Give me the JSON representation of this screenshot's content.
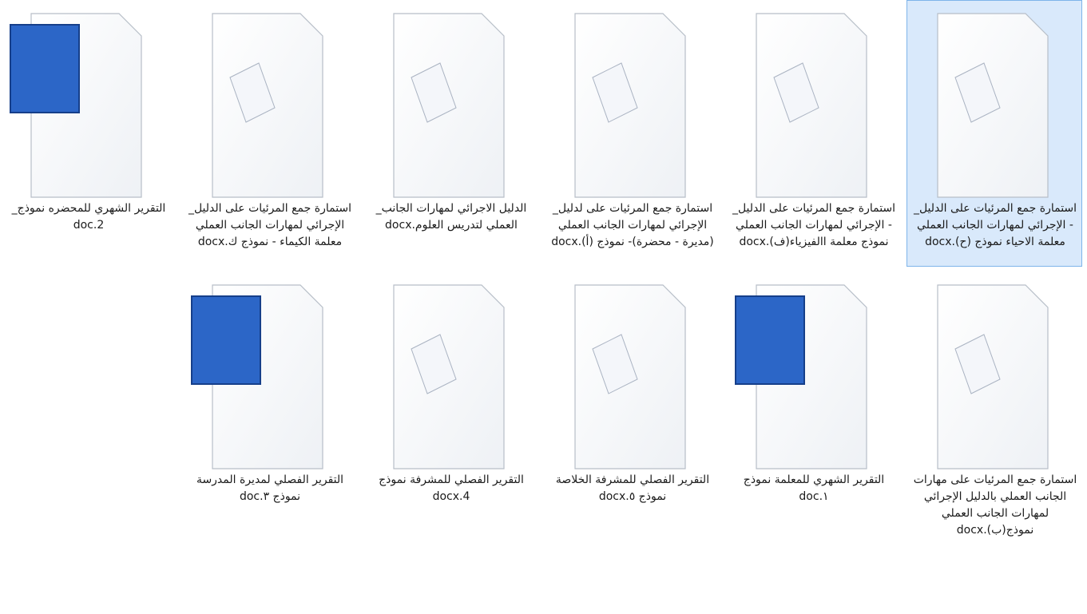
{
  "window": {
    "view": "Large icons",
    "selected_file": "استمارة جمع المرئيات على الدليل_ - الإجرائي لمهارات الجانب العملي معلمة الاحياء نموذج (ح).docx"
  },
  "files": [
    {
      "name": "استمارة جمع المرئيات على الدليل_ - الإجرائي لمهارات الجانب العملي معلمة الاحياء نموذج (ح).docx",
      "lines": [
        "استمارة جمع المرئيات على الدليل_",
        "- الإجرائي لمهارات الجانب العملي",
        "معلمة الاحياء نموذج (ح).docx"
      ],
      "type": "docx",
      "icon": "word-2007-document-icon"
    },
    {
      "name": "استمارة جمع المرئيات على الدليل_ - الإجرائي لمهارات الجانب العملي نموذج معلمة االفيزياء(ف).docx",
      "lines": [
        "استمارة جمع المرئيات على الدليل_",
        "- الإجرائي لمهارات الجانب العملي",
        "نموذج معلمة االفيزياء(ف).docx"
      ],
      "type": "docx",
      "icon": "word-2007-document-icon"
    },
    {
      "name": "استمارة جمع المرئيات على لدليل_ الإجرائي لمهارات الجانب العملي (مديرة - محضرة)- نموذج (أ).docx",
      "lines": [
        "استمارة جمع المرئيات على لدليل_",
        "الإجرائي لمهارات الجانب العملي",
        "(مديرة - محضرة)- نموذج (أ).docx"
      ],
      "type": "docx",
      "icon": "word-2007-document-icon"
    },
    {
      "name": "الدليل الاجرائي لمهارات الجانب_ العملي لتدريس العلوم.docx",
      "lines": [
        "الدليل الاجرائي لمهارات الجانب_",
        "العملي لتدريس العلوم.docx"
      ],
      "type": "docx",
      "icon": "word-2007-document-icon"
    },
    {
      "name": "استمارة جمع المرئيات على الدليل_ الإجرائي لمهارات الجانب العملي معلمة الكيماء - نموذج ك.docx",
      "lines": [
        "استمارة جمع المرئيات على الدليل_",
        "الإجرائي لمهارات الجانب العملي",
        "معلمة الكيماء - نموذج ك.docx"
      ],
      "type": "docx",
      "icon": "word-2007-document-icon"
    },
    {
      "name": "التقرير الشهري للمحضره نموذج_2.doc",
      "lines": [
        "التقرير الشهري للمحضره نموذج_",
        "2.doc"
      ],
      "type": "doc",
      "icon": "word-2003-document-icon"
    },
    {
      "name": "استمارة جمع المرئيات على مهارات الجانب العملي بالدليل الإجرائي لمهارات الجانب العملي نموذج(ب).docx",
      "lines": [
        "استمارة جمع المرئيات على مهارات",
        "الجانب العملي بالدليل الإجرائي",
        "لمهارات الجانب العملي",
        "نموذج(ب).docx"
      ],
      "type": "docx",
      "icon": "word-2007-document-icon"
    },
    {
      "name": "التقرير الشهري للمعلمة نموذج ١.doc",
      "lines": [
        "التقرير الشهري للمعلمة  نموذج ١.doc"
      ],
      "type": "doc",
      "icon": "word-2003-document-icon"
    },
    {
      "name": "التقرير الفصلي للمشرفة الخلاصة نموذج ٥.docx",
      "lines": [
        "التقرير الفصلي للمشرفة الخلاصة",
        "نموذج ٥.docx"
      ],
      "type": "docx",
      "icon": "word-2007-document-icon"
    },
    {
      "name": "التقرير الفصلي للمشرفة نموذج 4.docx",
      "lines": [
        "التقرير الفصلي للمشرفة نموذج",
        "4.docx"
      ],
      "type": "docx",
      "icon": "word-2007-document-icon"
    },
    {
      "name": "التقرير الفصلي لمديرة المدرسة نموذج ٣.doc",
      "lines": [
        "التقرير الفصلي لمديرة المدرسة",
        "نموذج ٣.doc"
      ],
      "type": "doc",
      "icon": "word-2003-document-icon"
    }
  ]
}
